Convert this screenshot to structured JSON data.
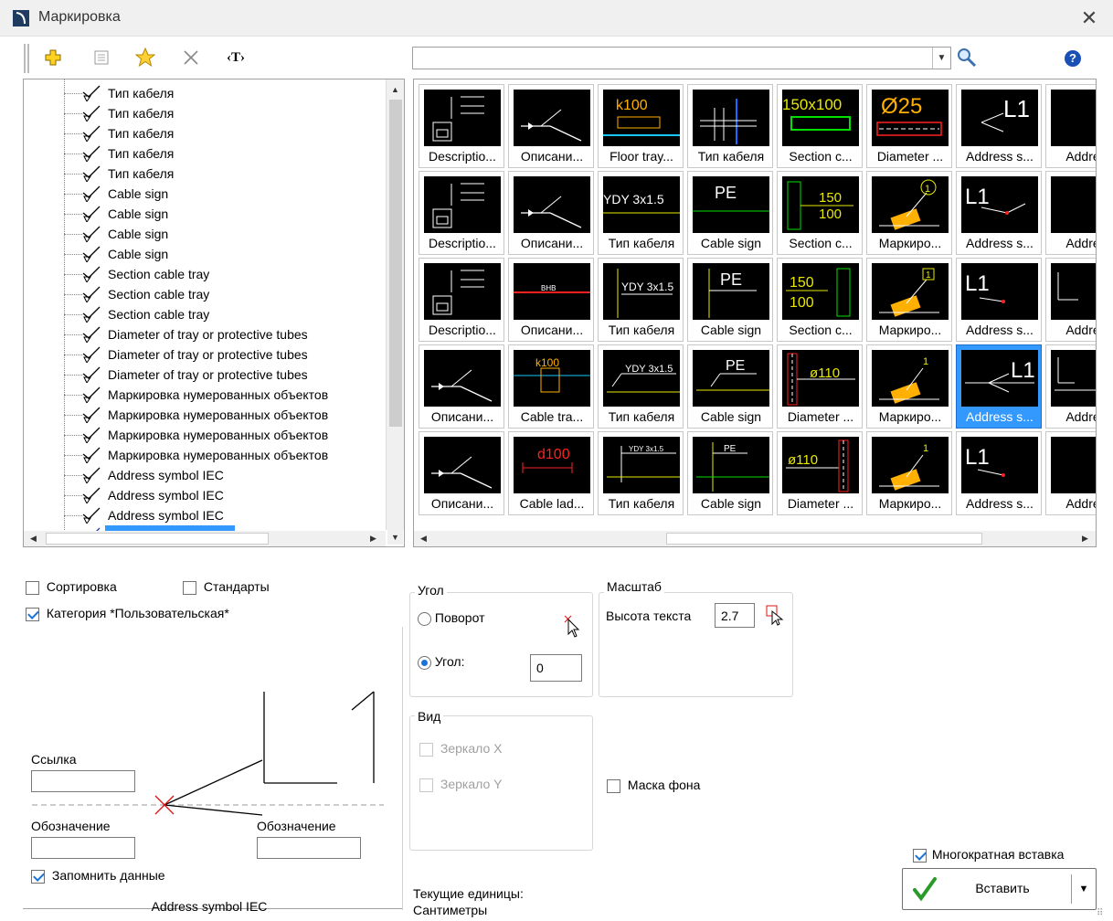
{
  "window": {
    "title": "Маркировка",
    "close_icon": "close-icon"
  },
  "toolbar": {
    "icons": [
      "add-icon",
      "properties-icon",
      "favorite-star-icon",
      "delete-icon",
      "text-style-icon"
    ],
    "text_style_label": "‹T›",
    "search": {
      "value": "",
      "placeholder": ""
    },
    "help_label": "?"
  },
  "tree": {
    "items": [
      {
        "label": "Тип кабеля"
      },
      {
        "label": "Тип кабеля"
      },
      {
        "label": "Тип кабеля"
      },
      {
        "label": "Тип кабеля"
      },
      {
        "label": "Тип кабеля"
      },
      {
        "label": "Cable sign"
      },
      {
        "label": "Cable sign"
      },
      {
        "label": "Cable sign"
      },
      {
        "label": "Cable sign"
      },
      {
        "label": "Section cable tray"
      },
      {
        "label": "Section cable tray"
      },
      {
        "label": "Section cable tray"
      },
      {
        "label": "Diameter of tray or protective tubes"
      },
      {
        "label": "Diameter of tray or protective tubes"
      },
      {
        "label": "Diameter of tray or protective tubes"
      },
      {
        "label": "Маркировка нумерованных объектов"
      },
      {
        "label": "Маркировка нумерованных объектов"
      },
      {
        "label": "Маркировка нумерованных объектов"
      },
      {
        "label": "Маркировка нумерованных объектов"
      },
      {
        "label": "Address symbol IEC"
      },
      {
        "label": "Address symbol IEC"
      },
      {
        "label": "Address symbol IEC"
      },
      {
        "label": "Address symbol IEC",
        "selected": true
      }
    ]
  },
  "gallery": {
    "rows": [
      [
        "Descriptio...",
        "Описани...",
        "Floor tray...",
        "Тип кабеля",
        "Section c...",
        "Diameter ...",
        "Address s...",
        "Address"
      ],
      [
        "Descriptio...",
        "Описани...",
        "Тип кабеля",
        "Cable sign",
        "Section c...",
        "Маркиро...",
        "Address s...",
        "Address"
      ],
      [
        "Descriptio...",
        "Описани...",
        "Тип кабеля",
        "Cable sign",
        "Section c...",
        "Маркиро...",
        "Address s...",
        "Address"
      ],
      [
        "Описани...",
        "Cable tra...",
        "Тип кабеля",
        "Cable sign",
        "Diameter ...",
        "Маркиро...",
        "Address s...",
        "Address"
      ],
      [
        "Описани...",
        "Cable lad...",
        "Тип кабеля",
        "Cable sign",
        "Diameter ...",
        "Маркиро...",
        "Address s...",
        "Address"
      ]
    ],
    "selected": {
      "row": 3,
      "col": 6
    },
    "thumb_texts": {
      "floor_tray": "k100",
      "section_150x100": "150x100",
      "diameter_25": "Ø25",
      "address_l1": "L1",
      "ydy": "YDY 3x1.5",
      "pe": "PE",
      "frac_top": "150",
      "frac_bottom": "100",
      "num_1": "1",
      "ladder": "d100",
      "diam_110": "ø110"
    }
  },
  "options": {
    "sort_label": "Сортировка",
    "standards_label": "Стандарты",
    "category_label": "Категория *Пользовательская*"
  },
  "preview": {
    "link_label": "Ссылка",
    "link_value": "",
    "designation_left_label": "Обозначение",
    "designation_left_value": "",
    "designation_right_label": "Обозначение",
    "designation_right_value": "",
    "remember_label": "Запомнить данные",
    "name": "Address symbol IEC",
    "glyph": "L1"
  },
  "angle": {
    "title": "Угол",
    "rotation_label": "Поворот",
    "angle_label": "Угол:",
    "angle_value": "0"
  },
  "scale": {
    "title": "Масштаб",
    "text_height_label": "Высота текста",
    "text_height_value": "2.7"
  },
  "view": {
    "title": "Вид",
    "mirror_x_label": "Зеркало X",
    "mirror_y_label": "Зеркало Y"
  },
  "mask_label": "Маска фона",
  "units": {
    "label": "Текущие единицы:",
    "value": "Сантиметры"
  },
  "multi_insert_label": "Многократная вставка",
  "insert_label": "Вставить",
  "colors": {
    "accent": "#3399ff",
    "check": "#1a73d9",
    "insert_check": "#2a9a2a",
    "help": "#1a4fb5"
  }
}
